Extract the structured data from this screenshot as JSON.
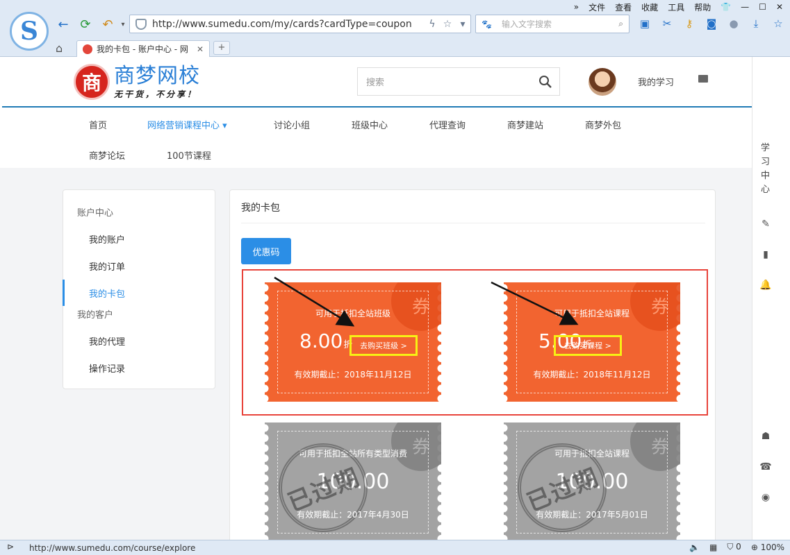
{
  "browser": {
    "menu": [
      "»",
      "文件",
      "查看",
      "收藏",
      "工具",
      "帮助"
    ],
    "url": "http://www.sumedu.com/my/cards?cardType=coupon",
    "search_placeholder": "输入文字搜索",
    "tab_title": "我的卡包 - 账户中心 - 网",
    "new_tab": "+",
    "status_url": "http://www.sumedu.com/course/explore",
    "zoom": "100%",
    "status_count": "0"
  },
  "header": {
    "brand_name": "商梦网校",
    "brand_seal": "商",
    "slogan": "无干货，不分享！",
    "search_placeholder": "搜索",
    "my_learning": "我的学习"
  },
  "nav": {
    "items": [
      "首页",
      "网络营销课程中心 ▾",
      "讨论小组",
      "班级中心",
      "代理查询",
      "商梦建站",
      "商梦外包",
      "商梦论坛",
      "100节课程"
    ]
  },
  "sidebar": {
    "group1": "账户中心",
    "items1": [
      "我的账户",
      "我的订单",
      "我的卡包"
    ],
    "group2": "我的客户",
    "items2": [
      "我的代理",
      "操作记录"
    ]
  },
  "main": {
    "title": "我的卡包",
    "tab": "优惠码"
  },
  "coupons": [
    {
      "desc": "可用于抵扣全站班级",
      "amount": "8.00",
      "unit": "折",
      "buy": "去购买班级 >",
      "expire": "有效期截止：2018年11月12日",
      "corner": "券",
      "status": "active"
    },
    {
      "desc": "可用于抵扣全站课程",
      "amount": "5.00",
      "unit": "折",
      "buy": "去购买课程 >",
      "expire": "有效期截止：2018年11月12日",
      "corner": "券",
      "status": "active"
    },
    {
      "desc": "可用于抵扣全站所有类型消费",
      "amount": "100.00",
      "expire": "有效期截止：2017年4月30日",
      "corner": "券",
      "stamp": "已过期",
      "status": "expired"
    },
    {
      "desc": "可用于抵扣全站课程",
      "amount": "100.00",
      "expire": "有效期截止：2017年5月01日",
      "corner": "券",
      "stamp": "已过期",
      "status": "expired"
    }
  ],
  "rail": {
    "label": "学习中心"
  },
  "colors": {
    "accent": "#2b8ee6",
    "coupon_active": "#f26430",
    "coupon_expired": "#a3a3a3",
    "highlight_box": "#e8433a",
    "buy_box": "#f7f015"
  }
}
